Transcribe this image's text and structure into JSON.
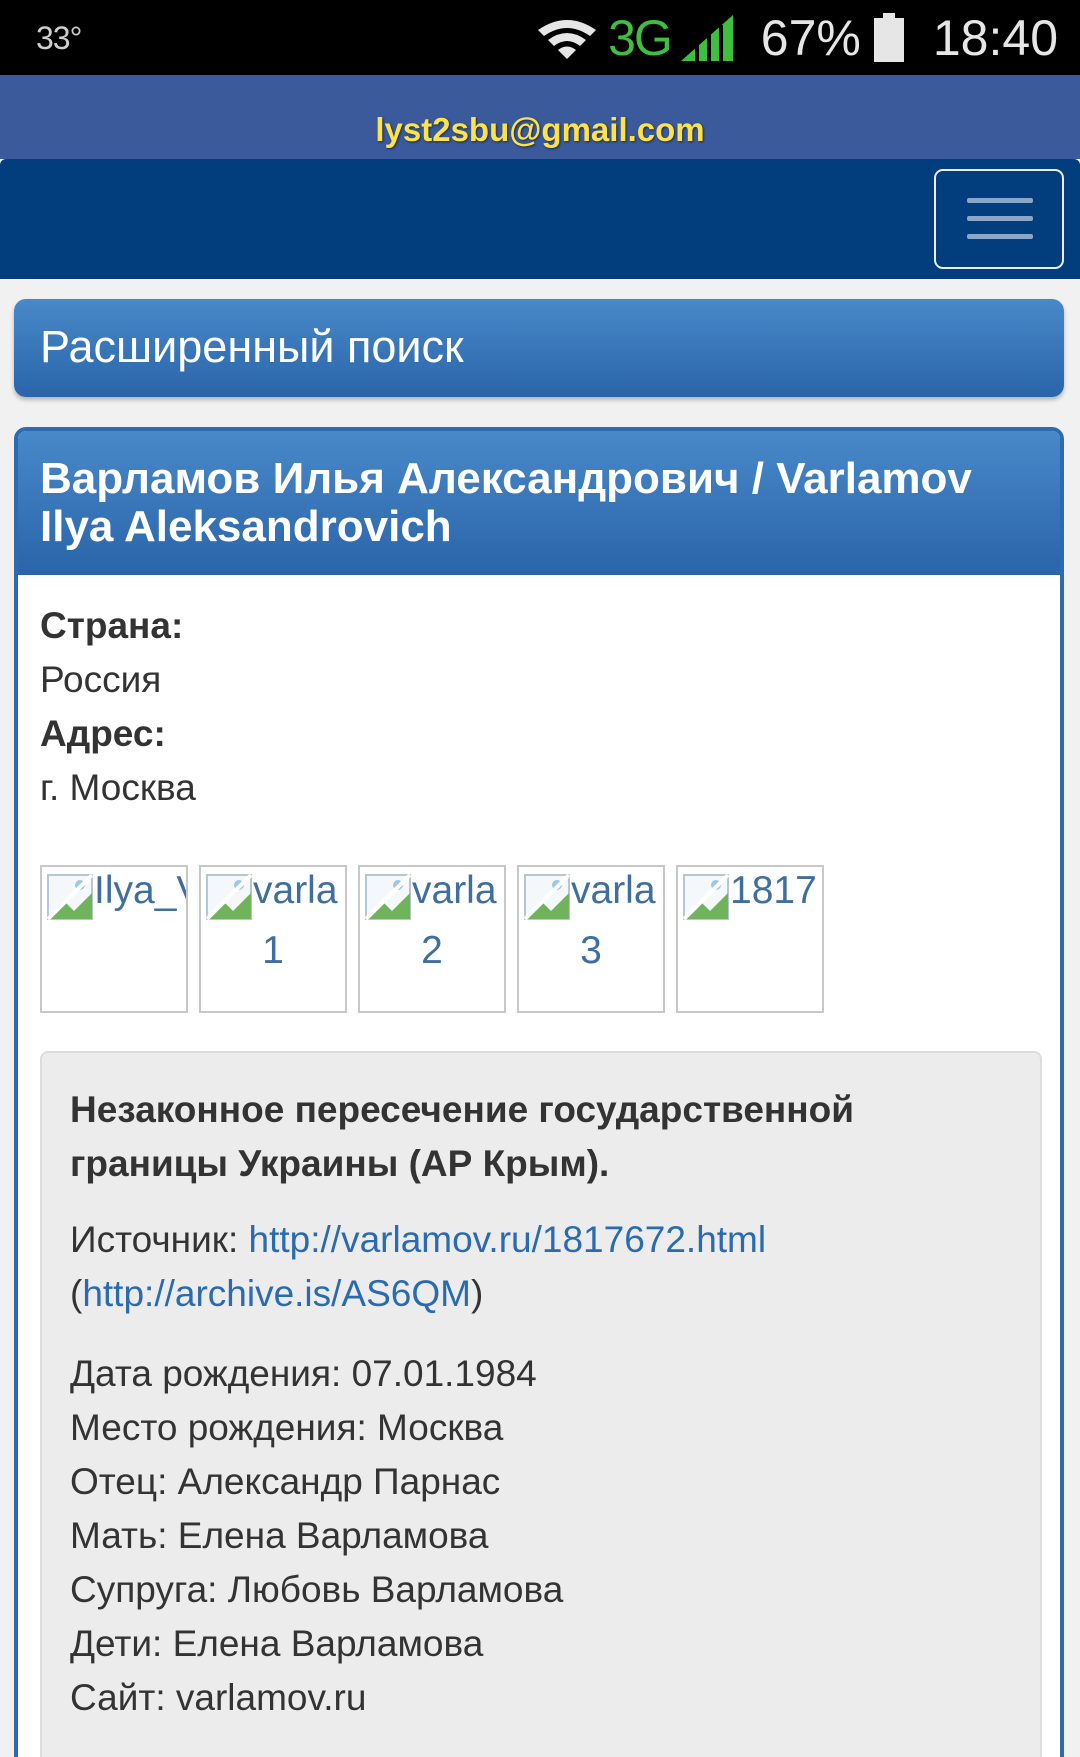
{
  "status_bar": {
    "temperature": "33°",
    "network": "3G",
    "battery_percent": "67%",
    "time": "18:40"
  },
  "header": {
    "email": "lyst2sbu@gmail.com"
  },
  "advanced_search": {
    "label": "Расширенный поиск"
  },
  "person": {
    "name": "Варламов Илья Александрович / Varlamov Ilya Aleksandrovich",
    "country_label": "Страна:",
    "country": "Россия",
    "address_label": "Адрес:",
    "address": "г. Москва",
    "thumbnails": [
      {
        "alt_line1": "Ilya_V",
        "alt_line2": ""
      },
      {
        "alt_line1": "varla",
        "alt_line2": "1"
      },
      {
        "alt_line1": "varla",
        "alt_line2": "2"
      },
      {
        "alt_line1": "varla",
        "alt_line2": "3"
      },
      {
        "alt_line1": "1817",
        "alt_line2": ""
      }
    ],
    "offense_title": "Незаконное пересечение государственной границы Украины (АР Крым).",
    "source_label": "Источник:",
    "source_url": "http://varlamov.ru/1817672.html",
    "archive_open": "(",
    "archive_url": "http://archive.is/AS6QM",
    "archive_close": ")",
    "facts": [
      "Дата рождения: 07.01.1984",
      "Место рождения: Москва",
      "Отец: Александр Парнас",
      "Мать: Елена Варламова",
      "Супруга: Любовь Варламова",
      "Дети: Елена Варламова",
      "Сайт: varlamov.ru"
    ]
  },
  "colors": {
    "navbar": "#023e7d",
    "email_bar": "#3a5a9b",
    "email_text": "#ffe14a",
    "panel_heading": "#2d6ab0",
    "link": "#2a6ab0"
  }
}
